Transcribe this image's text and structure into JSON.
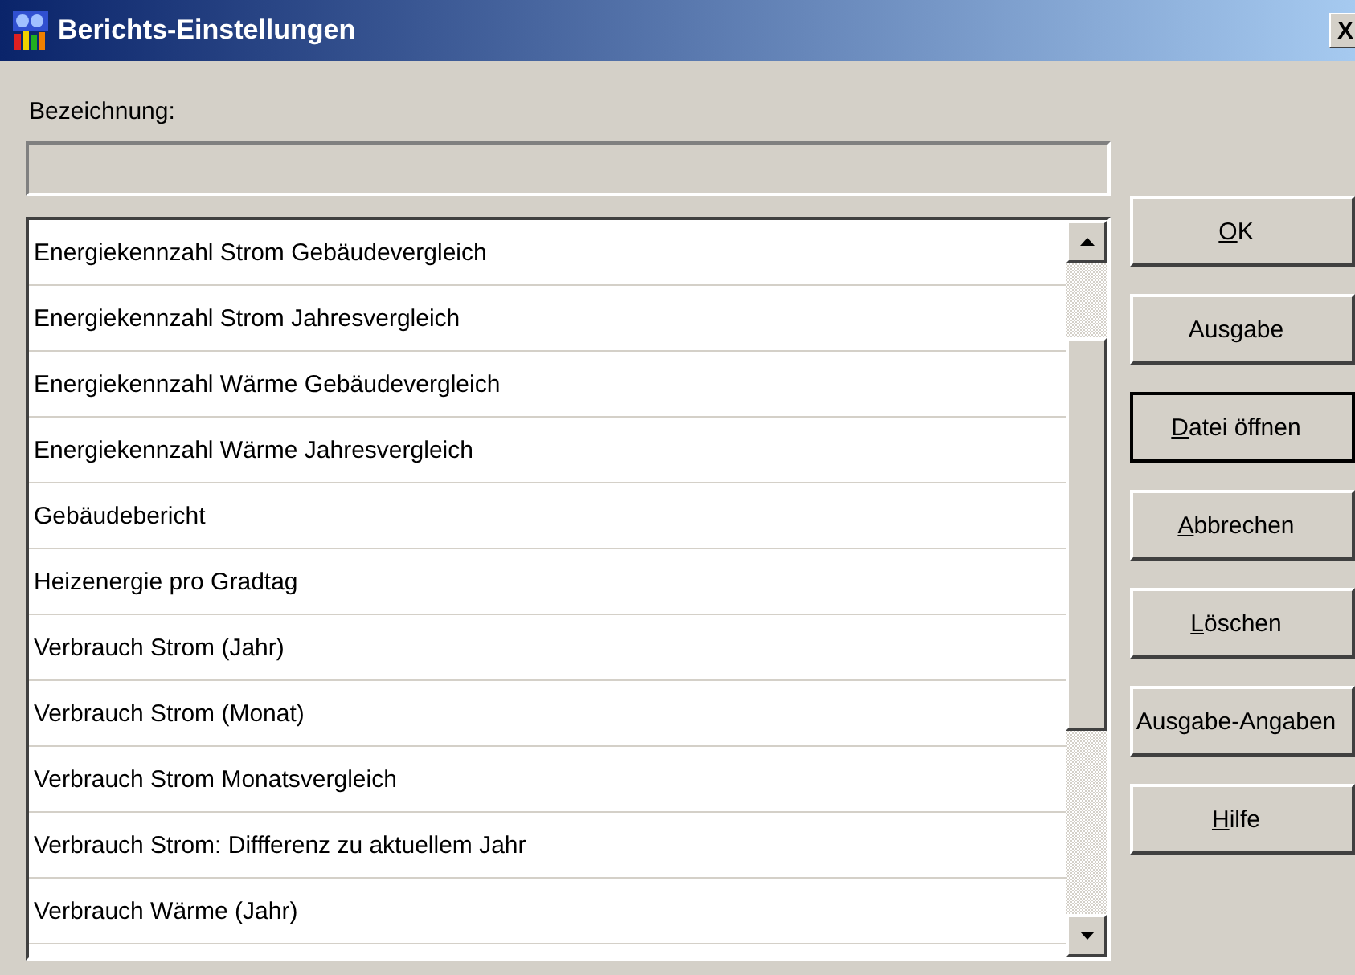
{
  "window": {
    "title": "Berichts-Einstellungen",
    "close": "X"
  },
  "name_field": {
    "label": "Bezeichnung:"
  },
  "report_list": {
    "items": [
      {
        "label": "Energiekennzahl Strom Gebäudevergleich",
        "selected": false
      },
      {
        "label": "Energiekennzahl Strom Jahresvergleich",
        "selected": false
      },
      {
        "label": "Energiekennzahl Wärme Gebäudevergleich",
        "selected": false
      },
      {
        "label": "Energiekennzahl Wärme Jahresvergleich",
        "selected": false
      },
      {
        "label": "Gebäudebericht",
        "selected": false
      },
      {
        "label": "Heizenergie pro Gradtag",
        "selected": false
      },
      {
        "label": "Verbrauch Strom (Jahr)",
        "selected": false
      },
      {
        "label": "Verbrauch Strom (Monat)",
        "selected": false
      },
      {
        "label": "Verbrauch Strom Monatsvergleich",
        "selected": false
      },
      {
        "label": "Verbrauch Strom: Diffferenz zu aktuellem Jahr",
        "selected": false
      },
      {
        "label": "Verbrauch Wärme (Jahr)",
        "selected": false
      }
    ]
  },
  "buttons": [
    {
      "label": "OK",
      "underline_first": true,
      "default": false
    },
    {
      "label": "Ausgabe",
      "underline_first": false,
      "default": false
    },
    {
      "label": "Datei öffnen",
      "underline_first": true,
      "default": true
    },
    {
      "label": "Abbrechen",
      "underline_first": true,
      "default": false
    },
    {
      "label": "Löschen",
      "underline_first": true,
      "default": false
    },
    {
      "label": "Ausgabe-Angaben",
      "underline_first": false,
      "default": false
    },
    {
      "label": "Hilfe",
      "underline_first": true,
      "default": false
    }
  ]
}
